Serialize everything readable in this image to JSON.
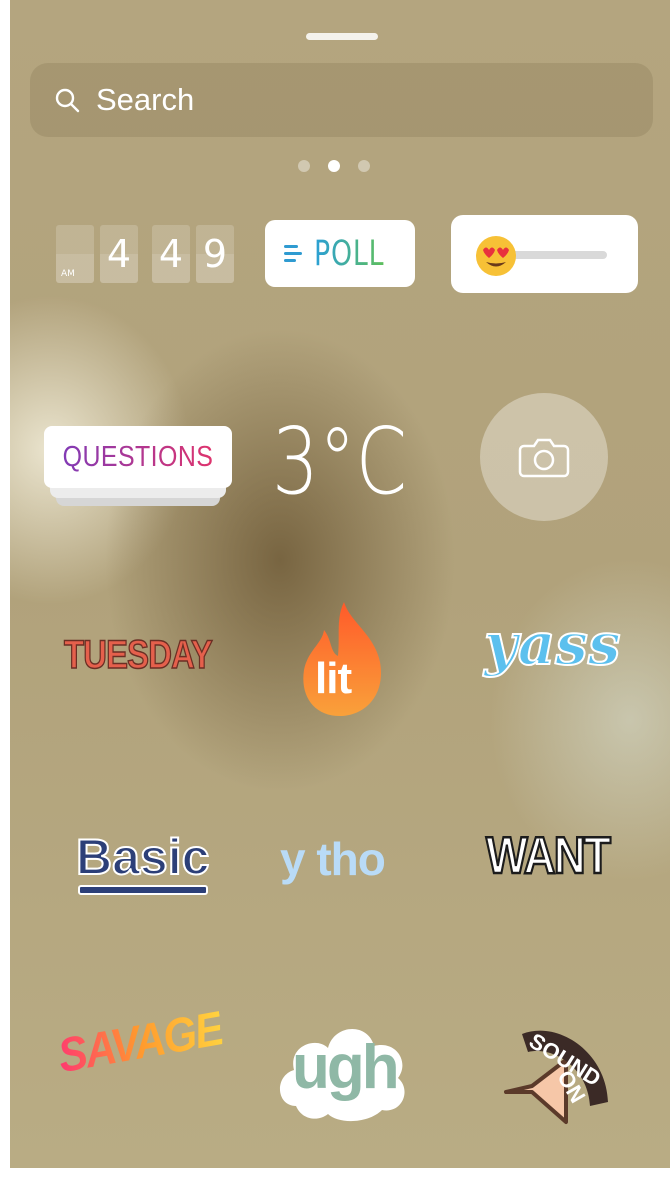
{
  "search": {
    "placeholder": "Search"
  },
  "pagination": {
    "count": 3,
    "active_index": 1
  },
  "stickers": {
    "clock": {
      "ampm": "AM",
      "digits": [
        "",
        "4",
        "4",
        "9"
      ]
    },
    "poll": {
      "label": "POLL"
    },
    "emoji_slider": {
      "emoji": "heart-eyes",
      "value": 0
    },
    "questions": {
      "label": "QUESTIONS"
    },
    "temperature": {
      "label": "3°C"
    },
    "camera": {
      "icon": "camera-icon"
    },
    "tuesday": {
      "label": "TUESDAY"
    },
    "lit": {
      "label": "lit",
      "icon": "fire-icon"
    },
    "yass": {
      "label": "yass"
    },
    "basic": {
      "label": "Basic"
    },
    "ytho": {
      "label": "y tho"
    },
    "want": {
      "label": "WANT"
    },
    "savage": {
      "label": "SAVAGE"
    },
    "ugh": {
      "label": "ugh"
    },
    "sound_on": {
      "label_top": "SOUND",
      "label_bottom": "ON",
      "icon": "speaker-icon"
    }
  },
  "colors": {
    "background": "#b4a57f",
    "poll_blue": "#2a9fd7",
    "poll_green": "#5fbf5b",
    "questions_purple": "#7e3bb8",
    "questions_pink": "#e2336a",
    "fire_orange": "#f47a2f",
    "basic_navy": "#2c3f78",
    "yass_blue": "#5cc0ee"
  }
}
